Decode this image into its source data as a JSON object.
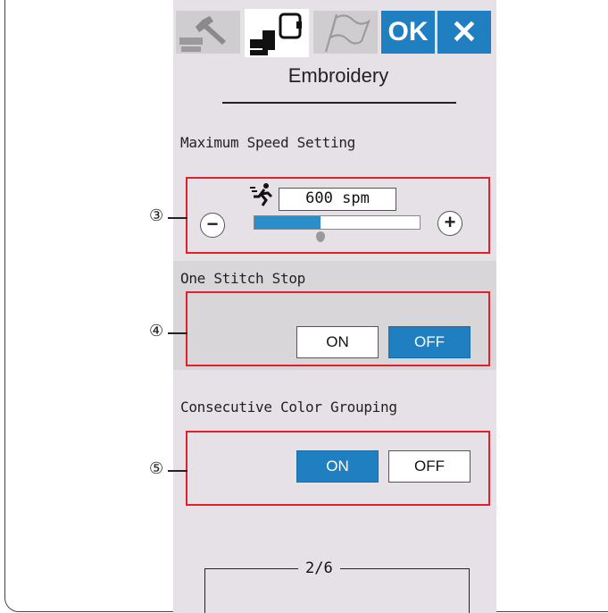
{
  "tabs": [
    {
      "name": "wrench-settings",
      "active": false
    },
    {
      "name": "embroidery-settings",
      "active": true
    },
    {
      "name": "language-flag",
      "active": false
    }
  ],
  "header": {
    "ok_label": "OK",
    "close_label": "✕"
  },
  "title": "Embroidery",
  "speed": {
    "label": "Maximum Speed Setting",
    "value": "600 spm",
    "minus": "−",
    "plus": "+",
    "slider_fraction": 0.4
  },
  "one_stitch": {
    "label": "One Stitch Stop",
    "on": "ON",
    "off": "OFF",
    "selected": "OFF"
  },
  "color_grouping": {
    "label": "Consecutive Color Grouping",
    "on": "ON",
    "off": "OFF",
    "selected": "ON"
  },
  "callouts": [
    "③",
    "④",
    "⑤"
  ],
  "page": "2/6",
  "colors": {
    "accent": "#1f7fc1",
    "highlight": "#e0202a",
    "screen_bg": "#e6e1e6"
  }
}
